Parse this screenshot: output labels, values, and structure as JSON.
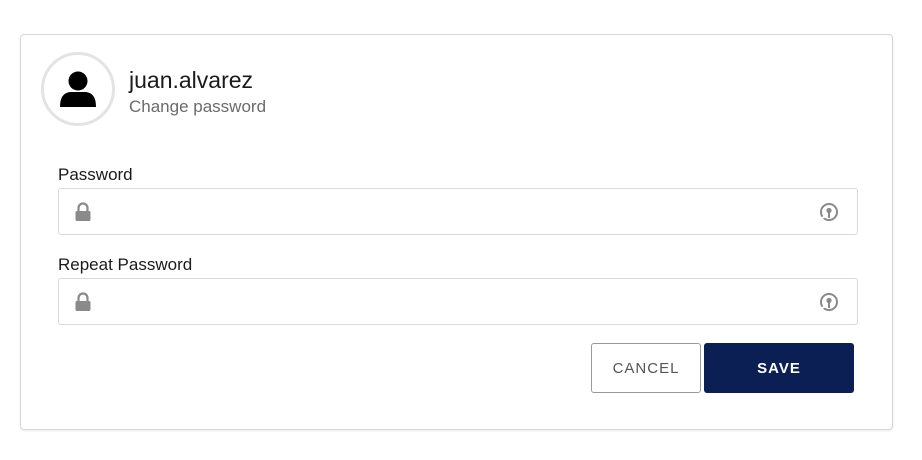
{
  "header": {
    "username": "juan.alvarez",
    "subtitle": "Change password"
  },
  "form": {
    "password": {
      "label": "Password",
      "value": "",
      "icon_left": "lock-icon",
      "icon_right": "show-password-icon"
    },
    "repeat_password": {
      "label": "Repeat Password",
      "value": "",
      "icon_left": "lock-icon",
      "icon_right": "show-password-icon"
    }
  },
  "actions": {
    "cancel_label": "CANCEL",
    "save_label": "SAVE"
  },
  "colors": {
    "primary": "#0b1f55",
    "border": "#d9d9d9",
    "icon_gray": "#8a8a8a"
  }
}
